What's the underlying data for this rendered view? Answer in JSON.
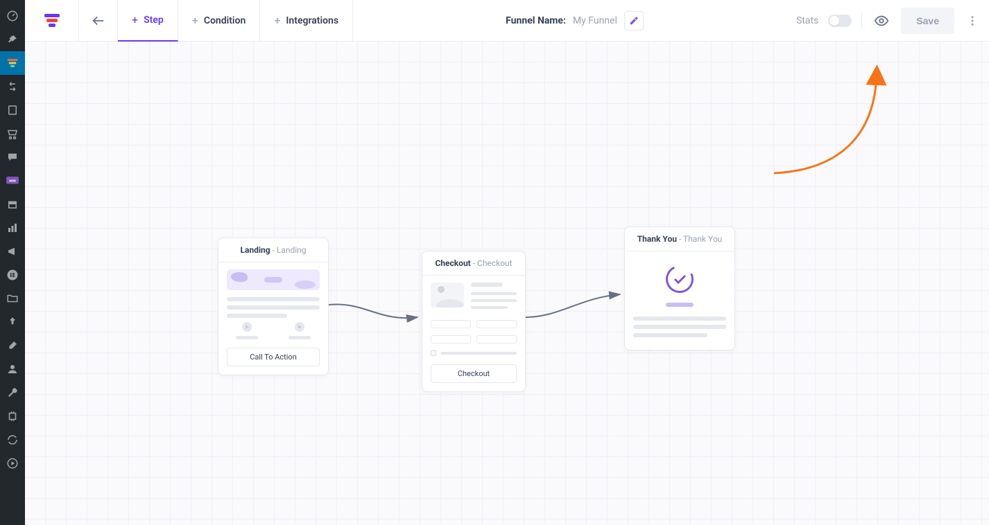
{
  "topbar": {
    "tabs": {
      "step": "Step",
      "condition": "Condition",
      "integrations": "Integrations"
    },
    "funnel_name_label": "Funnel Name:",
    "funnel_name_value": "My Funnel",
    "stats_label": "Stats",
    "save_label": "Save"
  },
  "cards": {
    "landing": {
      "title": "Landing",
      "subtitle": " - Landing",
      "action": "Call To Action"
    },
    "checkout": {
      "title": "Checkout",
      "subtitle": " - Checkout",
      "action": "Checkout"
    },
    "thank": {
      "title": "Thank You",
      "subtitle": " - Thank You"
    }
  },
  "sidebar_items": [
    "dashboard",
    "pin",
    "funnel",
    "templates",
    "pages",
    "cart",
    "chat",
    "woo",
    "archive",
    "analytics",
    "marketing",
    "elementor",
    "files",
    "tools",
    "brush",
    "users",
    "settings",
    "power",
    "refresh",
    "play"
  ]
}
